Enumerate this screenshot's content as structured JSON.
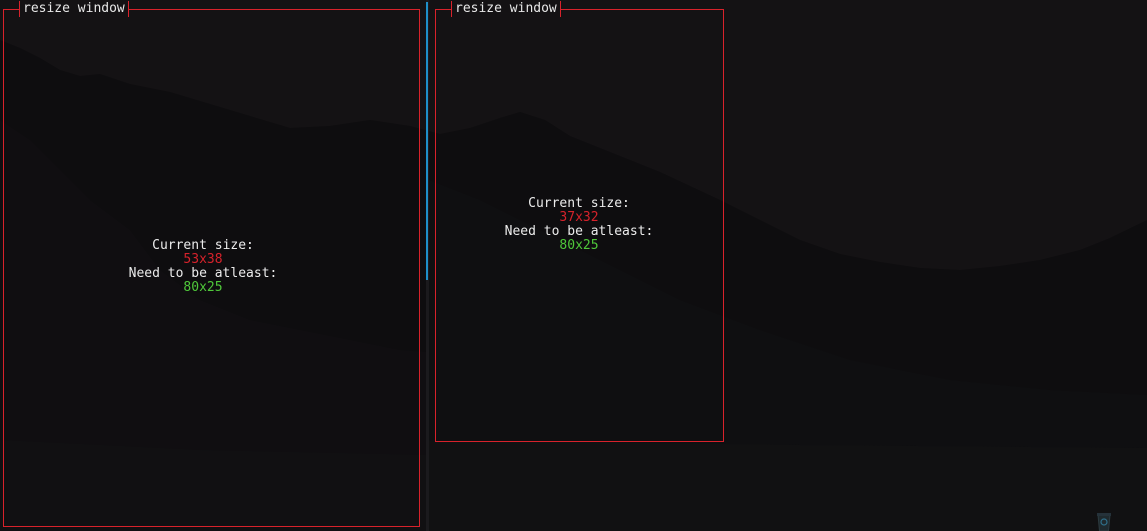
{
  "panes": [
    {
      "title": "resize window",
      "current_size_label": "Current size:",
      "current_size_value": "53x38",
      "required_label": "Need to be atleast:",
      "required_value": "80x25"
    },
    {
      "title": "resize window",
      "current_size_label": "Current size:",
      "current_size_value": "37x32",
      "required_label": "Need to be atleast:",
      "required_value": "80x25"
    }
  ],
  "colors": {
    "border": "#d8222b",
    "divider_active": "#1e8fc8",
    "current_value": "#d6222b",
    "required_value": "#4fc83a",
    "background": "#141214"
  },
  "icons": [
    "recycle-bin-icon"
  ]
}
